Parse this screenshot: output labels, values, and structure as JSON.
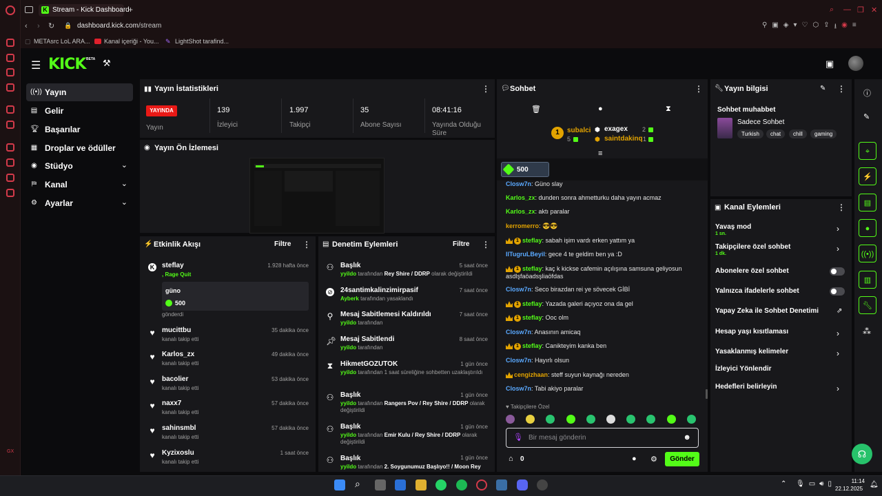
{
  "browser": {
    "tab_title": "Stream - Kick Dashboard",
    "url_host": "dashboard.kick.com",
    "url_path": "/stream",
    "bookmarks": [
      "METAsrc LoL ARA...",
      "Kanal içeriği - You...",
      "LightShot tarafind..."
    ]
  },
  "header": {
    "logo": "KICK",
    "logo_tag": "BETA"
  },
  "nav": [
    {
      "label": "Yayın",
      "icon": "broadcast-icon",
      "active": true
    },
    {
      "label": "Gelir",
      "icon": "revenue-icon"
    },
    {
      "label": "Başarılar",
      "icon": "trophy-icon"
    },
    {
      "label": "Droplar ve ödüller",
      "icon": "gift-icon"
    },
    {
      "label": "Stüdyo",
      "icon": "studio-icon",
      "expandable": true
    },
    {
      "label": "Kanal",
      "icon": "channel-icon",
      "expandable": true
    },
    {
      "label": "Ayarlar",
      "icon": "gear-icon",
      "expandable": true
    }
  ],
  "stats": {
    "title": "Yayın İstatistikleri",
    "live_badge": "YAYINDA",
    "live_label": "Yayın",
    "viewers": {
      "value": "139",
      "label": "İzleyici"
    },
    "followers": {
      "value": "1.997",
      "label": "Takipçi"
    },
    "subs": {
      "value": "35",
      "label": "Abone Sayısı"
    },
    "uptime": {
      "value": "08:41:16",
      "label": "Yayında Olduğu Süre"
    }
  },
  "preview": {
    "title": "Yayın Ön İzlemesi"
  },
  "activity": {
    "title": "Etkinlik Akışı",
    "filter": "Filtre",
    "items": [
      {
        "name": "steflay",
        "sub": ", Rage Quit",
        "time": "1.928 hafta önce",
        "gift_user": "güno",
        "gift_amount": "500",
        "gift_sub": "gönderdi"
      },
      {
        "name": "mucittbu",
        "sub": "kanalı takip etti",
        "time": "35 dakika önce"
      },
      {
        "name": "Karlos_zx",
        "sub": "kanalı takip etti",
        "time": "49 dakika önce"
      },
      {
        "name": "bacolier",
        "sub": "kanalı takip etti",
        "time": "53 dakika önce"
      },
      {
        "name": "naxx7",
        "sub": "kanalı takip etti",
        "time": "57 dakika önce"
      },
      {
        "name": "sahinsmbl",
        "sub": "kanalı takip etti",
        "time": "57 dakika önce"
      },
      {
        "name": "Kyzixoslu",
        "sub": "kanalı takip etti",
        "time": "1 saat önce"
      }
    ]
  },
  "moderation": {
    "title": "Denetim Eylemleri",
    "filter": "Filtre",
    "items": [
      {
        "name": "Başlık",
        "time": "5 saat önce",
        "actor": "yyildo",
        "text": "tarafından",
        "target": "Rey Shire / DDRP",
        "tail": "olarak değiştirildi"
      },
      {
        "name": "24santimkalinzimirpasif",
        "time": "7 saat önce",
        "actor": "Ayberk",
        "text": "tarafından yasaklandı"
      },
      {
        "name": "Mesaj Sabitlemesi Kaldırıldı",
        "time": "7 saat önce",
        "actor": "yyildo",
        "text": "tarafından"
      },
      {
        "name": "Mesaj Sabitlendi",
        "time": "8 saat önce",
        "actor": "yyildo",
        "text": "tarafından"
      },
      {
        "name": "HikmetGOZUTOK",
        "time": "1 gün önce",
        "actor": "yyildo",
        "text": "tarafından 1 saat süreliğine sohbetten uzaklaştırıldı"
      },
      {
        "name": "Başlık",
        "time": "1 gün önce",
        "actor": "yyildo",
        "text": "tarafından",
        "target": "Rangers Pov / Rey Shire / DDRP",
        "tail": "olarak değiştirildi"
      },
      {
        "name": "Başlık",
        "time": "1 gün önce",
        "actor": "yyildo",
        "text": "tarafından",
        "target": "Emir Kulu / Rey Shire / DDRP",
        "tail": "olarak değiştirildi"
      },
      {
        "name": "Başlık",
        "time": "1 gün önce",
        "actor": "yyildo",
        "text": "tarafından",
        "target": "2. Soygunumuz Başlıyo!! / Moon Rey",
        "tail": ""
      }
    ]
  },
  "chat": {
    "title": "Sohbet",
    "top": [
      {
        "name": "subalci",
        "count": "5",
        "rank": "1"
      },
      {
        "name": "exagex",
        "count": "2"
      },
      {
        "name": "saintdakinq",
        "count": "1"
      }
    ],
    "kicks_amount": "500",
    "messages": [
      {
        "user": "Closw7n",
        "text": ": Güno slay",
        "color": "#5aa9ff"
      },
      {
        "user": "Karlos_zx",
        "text": ": dunden sonra ahmetturku daha yayın acmaz",
        "color": "#53fc18"
      },
      {
        "user": "Karlos_zx",
        "text": ": aktı paralar",
        "color": "#53fc18"
      },
      {
        "user": "kerromerro",
        "text": ": 😎😎",
        "color": "#e2a300"
      },
      {
        "user": "steflay",
        "text": ": sabah işim vardı erken yattım ya",
        "color": "#53fc18",
        "badges": true
      },
      {
        "user": "IlTugruLBeyil",
        "text": ": gece 4 te geldim ben ya :D",
        "color": "#5aa9ff"
      },
      {
        "user": "steflay",
        "text": ": kaç k kickse cafemin açılışına samsuna geliyosun",
        "text2": "asdlşfaöadsşliaöfdas",
        "color": "#53fc18",
        "badges": true
      },
      {
        "user": "Closw7n",
        "text": ": Seco birazdan rei ye sövecek GİBİ",
        "color": "#5aa9ff"
      },
      {
        "user": "steflay",
        "text": ": Yazada galeri açıyoz ona da gel",
        "color": "#53fc18",
        "badges": true
      },
      {
        "user": "steflay",
        "text": ": Ooc olm",
        "color": "#53fc18",
        "badges": true
      },
      {
        "user": "Closw7n",
        "text": ": Anasının amicaq",
        "color": "#5aa9ff"
      },
      {
        "user": "steflay",
        "text": ": Canikteyim kanka ben",
        "color": "#53fc18",
        "badges": true
      },
      {
        "user": "Closw7n",
        "text": ": Hayırlı olsun",
        "color": "#5aa9ff"
      },
      {
        "user": "cengizhaan",
        "text": ": steff suyun kaynağı nereden",
        "color": "#e2a300",
        "crown": true
      },
      {
        "user": "Closw7n",
        "text": ": Tabi akiyo paralar",
        "color": "#5aa9ff"
      }
    ],
    "followers_only": "Takipçilere Özel",
    "input_placeholder": "Bir mesaj gönderin",
    "points": "0",
    "send": "Gönder"
  },
  "info": {
    "title": "Yayın bilgisi",
    "category": "Sohbet muhabbet",
    "game": "Sadece Sohbet",
    "tags": [
      "Turkish",
      "chat",
      "chill",
      "gaming"
    ]
  },
  "channel_actions": {
    "title": "Kanal Eylemleri",
    "items": [
      {
        "label": "Yavaş mod",
        "sub": "1 sn.",
        "type": "arrow"
      },
      {
        "label": "Takipçilere özel sohbet",
        "sub": "1 dk.",
        "type": "arrow"
      },
      {
        "label": "Abonelere özel sohbet",
        "type": "toggle"
      },
      {
        "label": "Yalnızca ifadelerle sohbet",
        "type": "toggle"
      },
      {
        "label": "Yapay Zeka ile Sohbet Denetimi",
        "type": "external"
      },
      {
        "label": "Hesap yaşı kısıtlaması",
        "type": "arrow"
      },
      {
        "label": "Yasaklanmış kelimeler",
        "type": "arrow"
      },
      {
        "label": "İzleyici Yönlendir",
        "type": "none"
      },
      {
        "label": "Hedefleri belirleyin",
        "type": "arrow"
      }
    ]
  },
  "taskbar": {
    "time": "11:14",
    "date": "22.12.2025"
  },
  "colors": {
    "accent": "#53fc18",
    "live": "#e91916",
    "panel": "#18181b"
  }
}
